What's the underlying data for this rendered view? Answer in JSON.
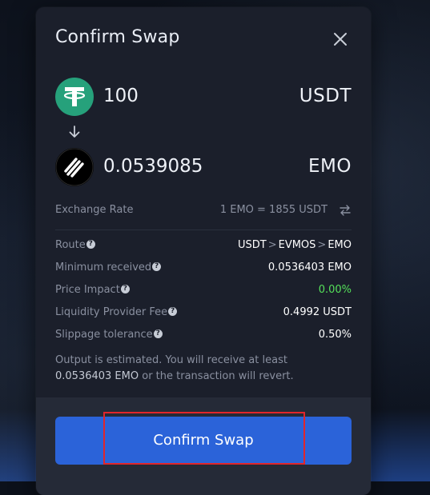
{
  "modal": {
    "title": "Confirm Swap",
    "close_icon": "close-icon"
  },
  "swap": {
    "from": {
      "amount": "100",
      "symbol": "USDT",
      "icon": "tether-icon",
      "icon_color": "#26a17b"
    },
    "to": {
      "amount": "0.0539085",
      "symbol": "EMO",
      "icon": "emo-icon",
      "icon_color": "#000000"
    },
    "arrow_icon": "arrow-down-icon"
  },
  "rate": {
    "label": "Exchange Rate",
    "value": "1 EMO = 1855 USDT",
    "toggle_icon": "swap-arrows-icon"
  },
  "details": {
    "route": {
      "label": "Route",
      "hops": [
        "USDT",
        "EVMOS",
        "EMO"
      ],
      "separator": ">"
    },
    "minimum_received": {
      "label": "Minimum received",
      "value": "0.0536403 EMO"
    },
    "price_impact": {
      "label": "Price Impact",
      "value": "0.00%",
      "color": "#55e05a"
    },
    "lp_fee": {
      "label": "Liquidity Provider Fee",
      "value": "0.4992 USDT"
    },
    "slippage": {
      "label": "Slippage tolerance",
      "value": "0.50%"
    },
    "help_glyph": "?"
  },
  "note": {
    "part1": "Output is estimated. You will receive at least",
    "amount": "0.0536403 EMO",
    "part2": "or the transaction will revert."
  },
  "footer": {
    "confirm_label": "Confirm Swap",
    "button_color": "#2b63d9"
  },
  "colors": {
    "modal_bg": "#1b1f2b",
    "footer_bg": "#252a37",
    "muted_text": "#8a90a0",
    "highlight": "#e1262b"
  }
}
